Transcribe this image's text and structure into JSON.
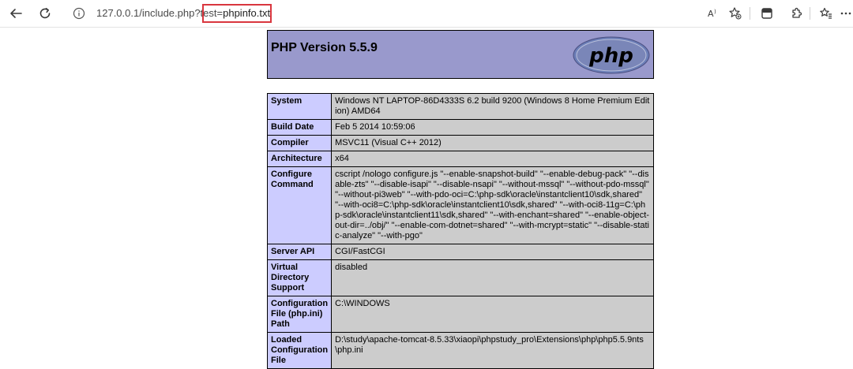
{
  "browser": {
    "url_prefix": "127.0.0.1/include.php?test=",
    "url_query": "phpinfo.txt"
  },
  "page": {
    "title": "PHP Version 5.5.9",
    "logo_text": "php",
    "rows": [
      {
        "key": "System",
        "value": "Windows NT LAPTOP-86D4333S 6.2 build 9200 (Windows 8 Home Premium Edition) AMD64"
      },
      {
        "key": "Build Date",
        "value": "Feb 5 2014 10:59:06"
      },
      {
        "key": "Compiler",
        "value": "MSVC11 (Visual C++ 2012)"
      },
      {
        "key": "Architecture",
        "value": "x64"
      },
      {
        "key": "Configure Command",
        "value": "cscript /nologo configure.js \"--enable-snapshot-build\" \"--enable-debug-pack\" \"--disable-zts\" \"--disable-isapi\" \"--disable-nsapi\" \"--without-mssql\" \"--without-pdo-mssql\" \"--without-pi3web\" \"--with-pdo-oci=C:\\php-sdk\\oracle\\instantclient10\\sdk,shared\" \"--with-oci8=C:\\php-sdk\\oracle\\instantclient10\\sdk,shared\" \"--with-oci8-11g=C:\\php-sdk\\oracle\\instantclient11\\sdk,shared\" \"--with-enchant=shared\" \"--enable-object-out-dir=../obj/\" \"--enable-com-dotnet=shared\" \"--with-mcrypt=static\" \"--disable-static-analyze\" \"--with-pgo\""
      },
      {
        "key": "Server API",
        "value": "CGI/FastCGI"
      },
      {
        "key": "Virtual Directory Support",
        "value": "disabled"
      },
      {
        "key": "Configuration File (php.ini) Path",
        "value": "C:\\WINDOWS"
      },
      {
        "key": "Loaded Configuration File",
        "value": "D:\\study\\apache-tomcat-8.5.33\\xiaopi\\phpstudy_pro\\Extensions\\php\\php5.5.9nts\\php.ini"
      }
    ]
  },
  "colors": {
    "header_bg": "#9999cc",
    "key_bg": "#ccccff",
    "value_bg": "#cccccc",
    "highlight": "#d9363e"
  }
}
